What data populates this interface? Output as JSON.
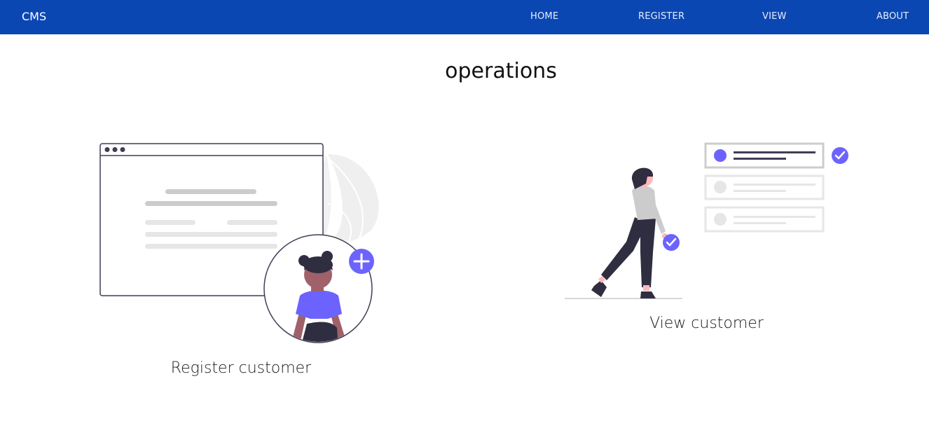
{
  "app": {
    "brand": "CMS"
  },
  "nav": {
    "items": [
      {
        "label": "HOME"
      },
      {
        "label": "REGISTER"
      },
      {
        "label": "VIEW"
      },
      {
        "label": "ABOUT"
      }
    ]
  },
  "main": {
    "title": "operations",
    "cards": [
      {
        "label": "Register customer",
        "icon": "register-customer-illustration"
      },
      {
        "label": "View customer",
        "icon": "view-customer-illustration"
      }
    ]
  },
  "colors": {
    "navbar": "#0b47b3",
    "accent": "#6c63ff",
    "dark": "#2f2e41",
    "skin": "#a0616a"
  }
}
